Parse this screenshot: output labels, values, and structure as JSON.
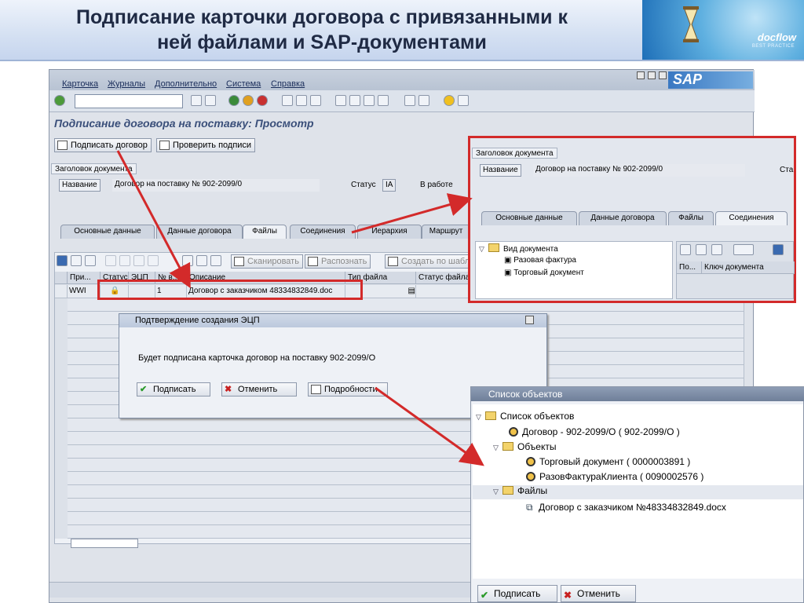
{
  "slide": {
    "title_line1": "Подписание карточки договора с привязанными к",
    "title_line2": "ней файлами и SAP-документами",
    "logo_text": "docflow",
    "logo_sub": "BEST PRACTICE"
  },
  "sap": {
    "menu": [
      "Карточка",
      "Журналы",
      "Дополнительно",
      "Система",
      "Справка"
    ],
    "logo": "SAP",
    "page_title": "Подписание договора на поставку: Просмотр",
    "buttons": {
      "sign": "Подписать договор",
      "verify": "Проверить подписи"
    },
    "header_group": "Заголовок документа",
    "name_label": "Название",
    "name_value": "Договор на поставку № 902-2099/0",
    "status_label": "Статус",
    "status_code": "IA",
    "status_text": "В работе",
    "tabs": [
      "Основные данные",
      "Данные договора",
      "Файлы",
      "Соединения",
      "Иерархия",
      "Маршрут"
    ],
    "files_toolbar": {
      "scan": "Сканировать",
      "recognize": "Распознать",
      "create_template": "Создать по шабл"
    },
    "grid_headers": [
      "При...",
      "Статус",
      "ЭЦП",
      "№ в...",
      "Описание",
      "Тип файла",
      "Статус файла"
    ],
    "grid_row": {
      "prefix": "WWI",
      "number": "1",
      "description": "Договор с заказчиком 48334832849.doc"
    }
  },
  "dialog": {
    "title": "Подтверждение создания ЭЦП",
    "message": "Будет подписана карточка договор на поставку 902-2099/О",
    "sign": "Подписать",
    "cancel": "Отменить",
    "details": "Подробности"
  },
  "zoom1": {
    "header_group": "Заголовок документа",
    "name_label": "Название",
    "name_value": "Договор на поставку № 902-2099/0",
    "status_partial": "Ста",
    "tabs": [
      "Основные данные",
      "Данные договора",
      "Файлы",
      "Соединения"
    ],
    "tree": [
      "Вид документа",
      "Разовая фактура",
      "Торговый документ"
    ],
    "table_headers": [
      "По...",
      "Ключ документа"
    ]
  },
  "zoom2": {
    "title": "Список объектов",
    "tree": [
      "Список объектов",
      "Договор - 902-2099/О ( 902-2099/О )",
      "Объекты",
      "Торговый документ ( 0000003891 )",
      "РазовФактураКлиента ( 0090002576 )",
      "Файлы",
      "Договор с заказчиком №48334832849.docx"
    ],
    "sign": "Подписать",
    "cancel": "Отменить"
  },
  "colors": {
    "highlight": "#d32a2a",
    "sap_title": "#3a4f7a"
  }
}
